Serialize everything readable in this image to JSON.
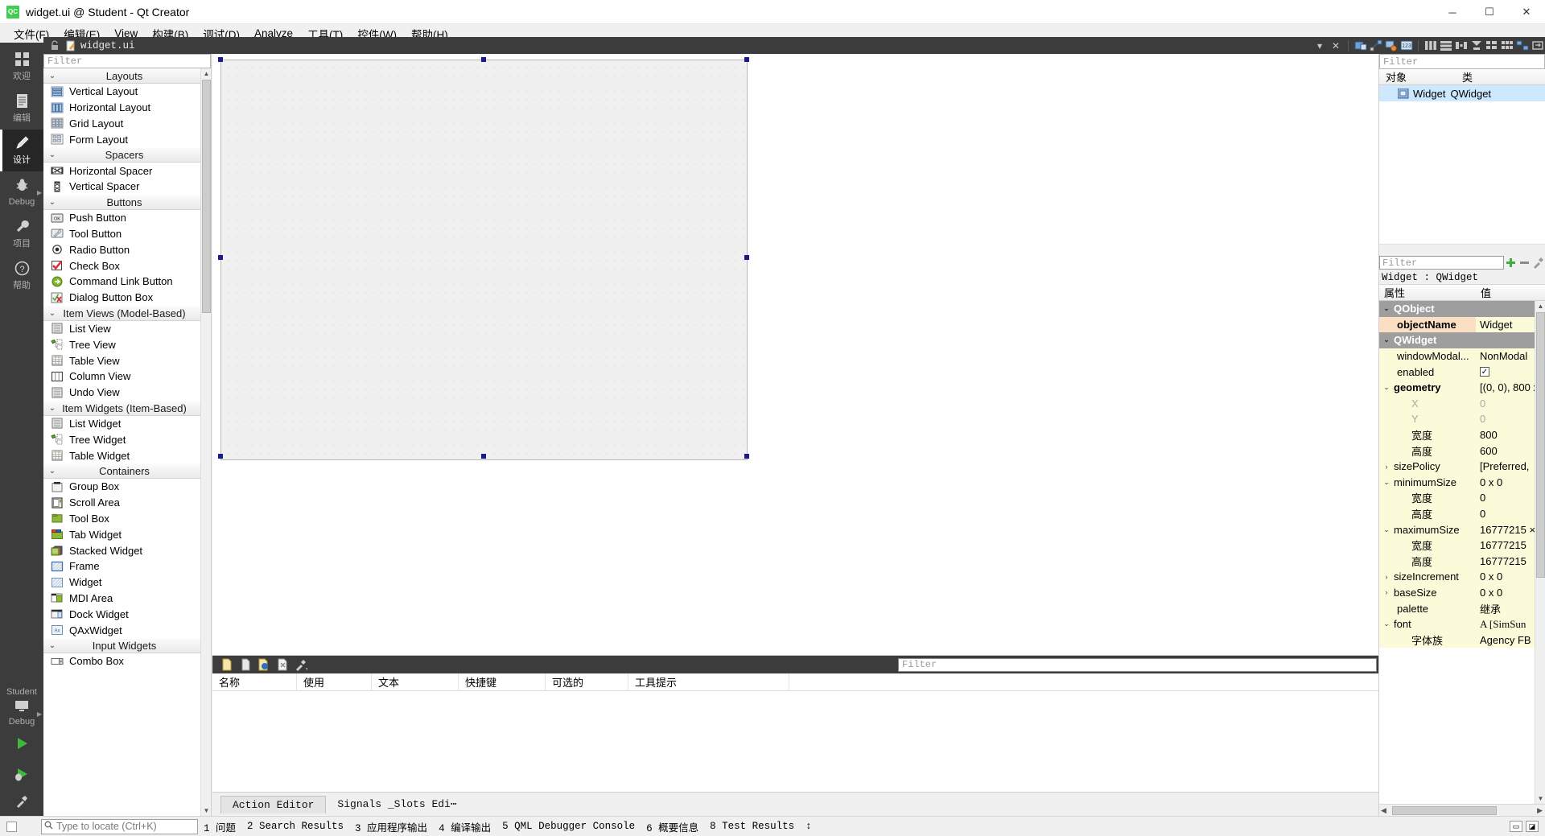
{
  "window": {
    "title": "widget.ui @ Student - Qt Creator",
    "logo": "QC",
    "minimize": "─",
    "maximize": "☐",
    "close": "✕"
  },
  "menubar": [
    {
      "label": "文件(F)",
      "name": "menu-file"
    },
    {
      "label": "编辑(E)",
      "name": "menu-edit"
    },
    {
      "label": "View",
      "name": "menu-view"
    },
    {
      "label": "构建(B)",
      "name": "menu-build"
    },
    {
      "label": "调试(D)",
      "name": "menu-debug"
    },
    {
      "label": "Analyze",
      "name": "menu-analyze"
    },
    {
      "label": "工具(T)",
      "name": "menu-tools"
    },
    {
      "label": "控件(W)",
      "name": "menu-window"
    },
    {
      "label": "帮助(H)",
      "name": "menu-help"
    }
  ],
  "modebar": {
    "items": [
      {
        "label": "欢迎",
        "icon": "grid-icon",
        "active": false
      },
      {
        "label": "编辑",
        "icon": "document-icon",
        "active": false
      },
      {
        "label": "设计",
        "icon": "pencil-ruler-icon",
        "active": true
      },
      {
        "label": "Debug",
        "icon": "bug-icon",
        "active": false
      },
      {
        "label": "项目",
        "icon": "wrench-icon",
        "active": false
      },
      {
        "label": "帮助",
        "icon": "question-icon",
        "active": false
      }
    ],
    "kit_label": "Student",
    "kit_mode": "Debug"
  },
  "doctoolbar": {
    "filename": "widget.ui",
    "dropdown": "▾",
    "close": "✕"
  },
  "widgetbox": {
    "filter_placeholder": "Filter",
    "groups": [
      {
        "title": "Layouts",
        "items": [
          {
            "label": "Vertical Layout",
            "icon": "vertical-layout-icon"
          },
          {
            "label": "Horizontal Layout",
            "icon": "horizontal-layout-icon"
          },
          {
            "label": "Grid Layout",
            "icon": "grid-layout-icon"
          },
          {
            "label": "Form Layout",
            "icon": "form-layout-icon"
          }
        ]
      },
      {
        "title": "Spacers",
        "items": [
          {
            "label": "Horizontal Spacer",
            "icon": "horizontal-spacer-icon"
          },
          {
            "label": "Vertical Spacer",
            "icon": "vertical-spacer-icon"
          }
        ]
      },
      {
        "title": "Buttons",
        "items": [
          {
            "label": "Push Button",
            "icon": "push-button-icon"
          },
          {
            "label": "Tool Button",
            "icon": "tool-button-icon"
          },
          {
            "label": "Radio Button",
            "icon": "radio-button-icon"
          },
          {
            "label": "Check Box",
            "icon": "check-box-icon"
          },
          {
            "label": "Command Link Button",
            "icon": "command-link-icon"
          },
          {
            "label": "Dialog Button Box",
            "icon": "dialog-button-box-icon"
          }
        ]
      },
      {
        "title": "Item Views (Model-Based)",
        "items": [
          {
            "label": "List View",
            "icon": "list-view-icon"
          },
          {
            "label": "Tree View",
            "icon": "tree-view-icon"
          },
          {
            "label": "Table View",
            "icon": "table-view-icon"
          },
          {
            "label": "Column View",
            "icon": "column-view-icon"
          },
          {
            "label": "Undo View",
            "icon": "undo-view-icon"
          }
        ]
      },
      {
        "title": "Item Widgets (Item-Based)",
        "items": [
          {
            "label": "List Widget",
            "icon": "list-widget-icon"
          },
          {
            "label": "Tree Widget",
            "icon": "tree-widget-icon"
          },
          {
            "label": "Table Widget",
            "icon": "table-widget-icon"
          }
        ]
      },
      {
        "title": "Containers",
        "items": [
          {
            "label": "Group Box",
            "icon": "group-box-icon"
          },
          {
            "label": "Scroll Area",
            "icon": "scroll-area-icon"
          },
          {
            "label": "Tool Box",
            "icon": "tool-box-icon"
          },
          {
            "label": "Tab Widget",
            "icon": "tab-widget-icon"
          },
          {
            "label": "Stacked Widget",
            "icon": "stacked-widget-icon"
          },
          {
            "label": "Frame",
            "icon": "frame-icon"
          },
          {
            "label": "Widget",
            "icon": "widget-icon"
          },
          {
            "label": "MDI Area",
            "icon": "mdi-area-icon"
          },
          {
            "label": "Dock Widget",
            "icon": "dock-widget-icon"
          },
          {
            "label": "QAxWidget",
            "icon": "qax-widget-icon"
          }
        ]
      },
      {
        "title": "Input Widgets",
        "items": [
          {
            "label": "Combo Box",
            "icon": "combo-box-icon"
          }
        ]
      }
    ]
  },
  "action_editor": {
    "filter_placeholder": "Filter",
    "columns": [
      "名称",
      "使用",
      "文本",
      "快捷键",
      "可选的",
      "工具提示"
    ],
    "rows": [],
    "tabs": [
      {
        "label": "Action Editor",
        "active": true
      },
      {
        "label": "Signals _Slots Edi⋯",
        "active": false
      }
    ]
  },
  "object_inspector": {
    "filter_placeholder": "Filter",
    "columns": [
      "对象",
      "类"
    ],
    "rows": [
      {
        "object": "Widget",
        "class": "QWidget",
        "icon": "widget-node-icon",
        "selected": true
      }
    ]
  },
  "property_editor": {
    "filter_placeholder": "Filter",
    "add_button": "+",
    "remove_button": "−",
    "config_button": "⚙",
    "object_line": "Widget : QWidget",
    "columns": [
      "属性",
      "值"
    ],
    "rows": [
      {
        "name": "QObject",
        "value": "",
        "kind": "group",
        "twist": "v",
        "indent": 0
      },
      {
        "name": "objectName",
        "value": "Widget",
        "kind": "peach",
        "twist": "",
        "indent": 1,
        "bold": true
      },
      {
        "name": "QWidget",
        "value": "",
        "kind": "group",
        "twist": "v",
        "indent": 0
      },
      {
        "name": "windowModal...",
        "value": "NonModal",
        "kind": "yellow",
        "twist": "",
        "indent": 1
      },
      {
        "name": "enabled",
        "value": "checkbox",
        "kind": "yellow",
        "twist": "",
        "indent": 1
      },
      {
        "name": "geometry",
        "value": "[(0, 0), 800 x",
        "kind": "yellow",
        "twist": "v",
        "indent": 0,
        "bold": true
      },
      {
        "name": "X",
        "value": "0",
        "kind": "yellow",
        "twist": "",
        "indent": 2,
        "dim": true
      },
      {
        "name": "Y",
        "value": "0",
        "kind": "yellow",
        "twist": "",
        "indent": 2,
        "dim": true
      },
      {
        "name": "宽度",
        "value": "800",
        "kind": "yellow",
        "twist": "",
        "indent": 2
      },
      {
        "name": "高度",
        "value": "600",
        "kind": "yellow",
        "twist": "",
        "indent": 2
      },
      {
        "name": "sizePolicy",
        "value": "[Preferred,",
        "kind": "yellow",
        "twist": ">",
        "indent": 0
      },
      {
        "name": "minimumSize",
        "value": "0 x 0",
        "kind": "yellow",
        "twist": "v",
        "indent": 0
      },
      {
        "name": "宽度",
        "value": "0",
        "kind": "yellow",
        "twist": "",
        "indent": 2
      },
      {
        "name": "高度",
        "value": "0",
        "kind": "yellow",
        "twist": "",
        "indent": 2
      },
      {
        "name": "maximumSize",
        "value": "16777215 ×",
        "kind": "yellow",
        "twist": "v",
        "indent": 0
      },
      {
        "name": "宽度",
        "value": "16777215",
        "kind": "yellow",
        "twist": "",
        "indent": 2
      },
      {
        "name": "高度",
        "value": "16777215",
        "kind": "yellow",
        "twist": "",
        "indent": 2
      },
      {
        "name": "sizeIncrement",
        "value": "0 x 0",
        "kind": "yellow",
        "twist": ">",
        "indent": 0
      },
      {
        "name": "baseSize",
        "value": "0 x 0",
        "kind": "yellow",
        "twist": ">",
        "indent": 0
      },
      {
        "name": "palette",
        "value": "继承",
        "kind": "yellow",
        "twist": "",
        "indent": 1
      },
      {
        "name": "font",
        "value": "A [SimSun",
        "kind": "yellow",
        "twist": "v",
        "indent": 0
      },
      {
        "name": "字体族",
        "value": "Agency FB",
        "kind": "yellow",
        "twist": "",
        "indent": 2
      }
    ]
  },
  "statusbar": {
    "locator_placeholder": "Type to locate (Ctrl+K)",
    "items": [
      "1 问题",
      "2 Search Results",
      "3 应用程序输出",
      "4 编译输出",
      "5 QML Debugger Console",
      "6 概要信息",
      "8 Test Results"
    ],
    "updown": "↕"
  }
}
